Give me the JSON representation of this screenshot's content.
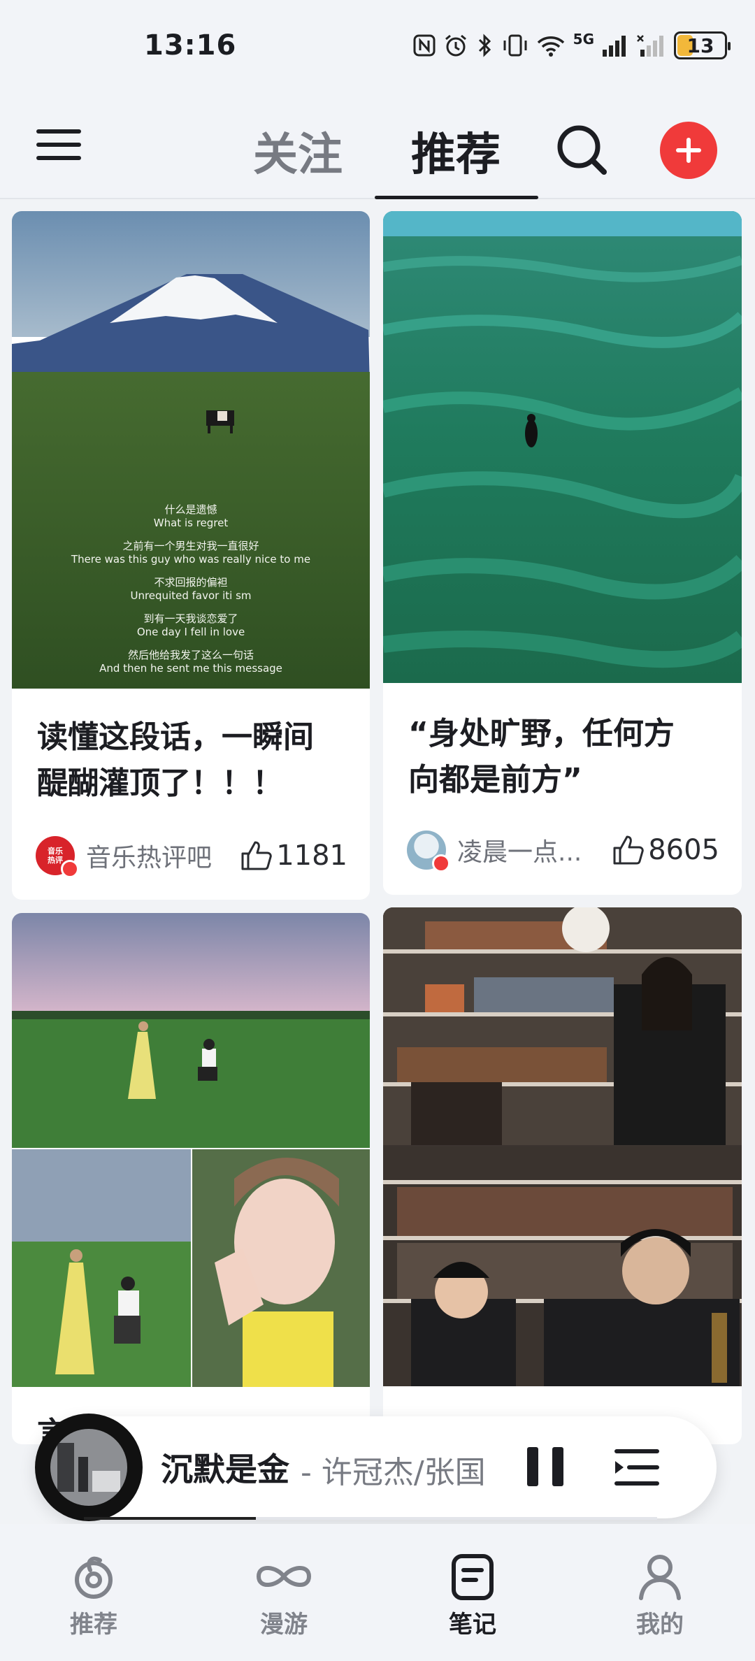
{
  "status_bar": {
    "time": "13:16",
    "network": "5G",
    "battery": "13"
  },
  "top_nav": {
    "tabs": [
      {
        "label": "关注",
        "active": false
      },
      {
        "label": "推荐",
        "active": true
      }
    ],
    "icons": [
      "menu-icon",
      "search-icon",
      "add-icon"
    ]
  },
  "feed": {
    "cards": [
      {
        "title_line1": "读懂这段话，一瞬间",
        "title_line2": "醍醐灌顶了！！！",
        "author": "音乐热评吧",
        "avatar_text": "音乐热评",
        "likes": "1181",
        "image_caption": [
          "什么是遗憾",
          "What is regret",
          "之前有一个男生对我一直很好",
          "There was this guy who was really nice to me",
          "不求回报的偏袒",
          "Unrequited favor iti sm",
          "到有一天我谈恋爱了",
          "One day I fell in love",
          "然后他给我发了这么一句话",
          "And then he sent me this message"
        ]
      },
      {
        "title_line1": "“身处旷野，任何方",
        "title_line2": "向都是前方”",
        "author": "凌晨一点...",
        "likes": "8605"
      },
      {
        "title_partial": "言"
      },
      {}
    ]
  },
  "player": {
    "song": "沉默是金",
    "artist": " - 许冠杰/张国",
    "progress": 0.3,
    "icons": [
      "pause-icon",
      "playlist-icon"
    ]
  },
  "bottom_nav": {
    "items": [
      {
        "label": "推荐",
        "icon": "recommend-icon",
        "active": false
      },
      {
        "label": "漫游",
        "icon": "infinity-icon",
        "active": false
      },
      {
        "label": "笔记",
        "icon": "notes-icon",
        "active": true
      },
      {
        "label": "我的",
        "icon": "profile-icon",
        "active": false
      }
    ]
  },
  "colors": {
    "accent_red": "#f03a3a",
    "background": "#f1f3f6",
    "text_primary": "#1c1d22",
    "text_secondary": "#777a82"
  }
}
